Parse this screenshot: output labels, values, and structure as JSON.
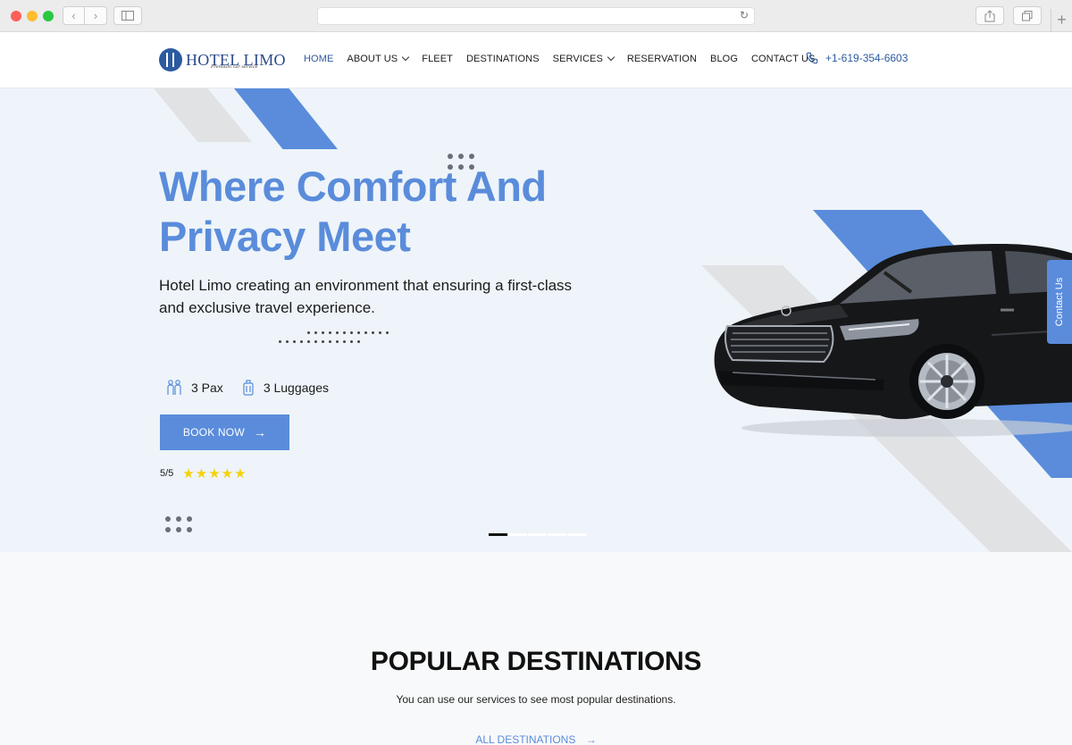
{
  "browser": {
    "back_icon": "chevron-left-icon",
    "forward_icon": "chevron-right-icon",
    "reload_icon": "reload-icon",
    "new_tab": "+"
  },
  "header": {
    "logo_text": "HOTEL LIMO",
    "logo_tagline": "Premium car service",
    "nav": [
      {
        "label": "HOME",
        "active": true
      },
      {
        "label": "ABOUT US",
        "dropdown": true
      },
      {
        "label": "FLEET"
      },
      {
        "label": "DESTINATIONS"
      },
      {
        "label": "SERVICES",
        "dropdown": true
      },
      {
        "label": "RESERVATION"
      },
      {
        "label": "BLOG"
      },
      {
        "label": "CONTACT US"
      }
    ],
    "phone": "+1-619-354-6603"
  },
  "hero": {
    "title_line1": "Where Comfort And",
    "title_line2": "Privacy Meet",
    "description": "Hotel Limo creating an environment that ensuring a first-class and exclusive travel experience.",
    "pax": "3 Pax",
    "luggages": "3 Luggages",
    "book_label": "BOOK NOW",
    "rating_text": "5/5",
    "stars": "★★★★★",
    "rating_value": 5,
    "rating_max": 5,
    "slides_total": 5,
    "slide_active": 1,
    "contact_tab": "Contact Us"
  },
  "destinations": {
    "title": "POPULAR DESTINATIONS",
    "subtitle": "You can use our services to see most popular destinations.",
    "link_label": "ALL DESTINATIONS"
  },
  "colors": {
    "accent": "#5a8cdb",
    "brand_dark": "#2c5aa0",
    "hero_bg": "#eef4f9",
    "star": "#f5d20a"
  }
}
